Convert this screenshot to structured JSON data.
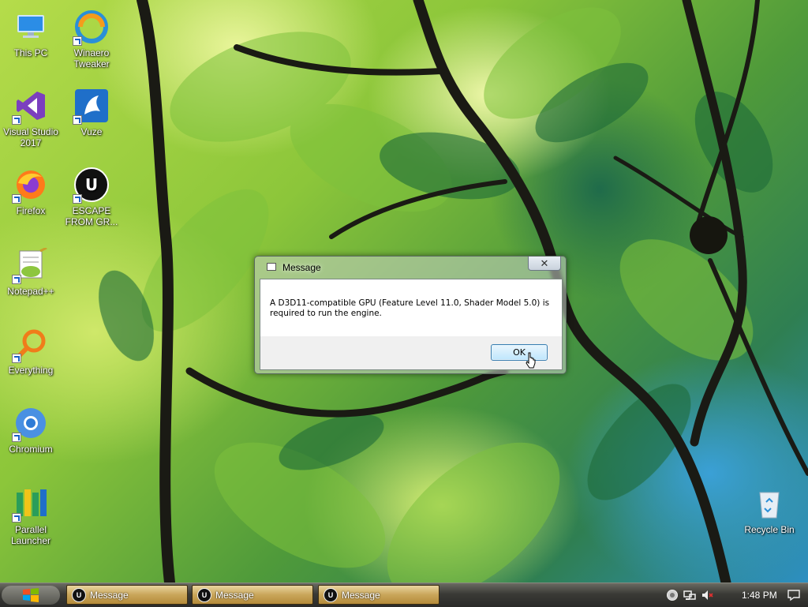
{
  "desktop": {
    "icons": [
      {
        "id": "this-pc",
        "label": "This PC"
      },
      {
        "id": "winaero",
        "label": "Winaero Tweaker"
      },
      {
        "id": "visual-studio",
        "label": "Visual Studio 2017"
      },
      {
        "id": "vuze",
        "label": "Vuze"
      },
      {
        "id": "firefox",
        "label": "Firefox"
      },
      {
        "id": "escape",
        "label": "ESCAPE FROM GR..."
      },
      {
        "id": "notepadpp",
        "label": "Notepad++"
      },
      {
        "id": "everything",
        "label": "Everything"
      },
      {
        "id": "chromium",
        "label": "Chromium"
      },
      {
        "id": "parallel",
        "label": "Parallel Launcher"
      },
      {
        "id": "recycle",
        "label": "Recycle Bin"
      }
    ]
  },
  "dialog": {
    "title": "Message",
    "close_glyph": "✕",
    "message": "A D3D11-compatible GPU (Feature Level 11.0, Shader Model 5.0) is required to run the engine.",
    "ok_label": "OK"
  },
  "taskbar": {
    "start_icon": "windows-logo-icon",
    "items": [
      {
        "label": "Message",
        "icon": "unreal-engine-icon"
      },
      {
        "label": "Message",
        "icon": "unreal-engine-icon"
      },
      {
        "label": "Message",
        "icon": "unreal-engine-icon"
      }
    ],
    "tray": {
      "icons": [
        "network-globe-icon",
        "network-icon",
        "volume-muted-icon",
        "notification-icon"
      ],
      "clock": "1:48 PM"
    }
  },
  "colors": {
    "taskbar_button": "#c9a65a",
    "ok_button_border": "#3c7fb1",
    "shortcut_arrow": "#1a5fc7"
  }
}
